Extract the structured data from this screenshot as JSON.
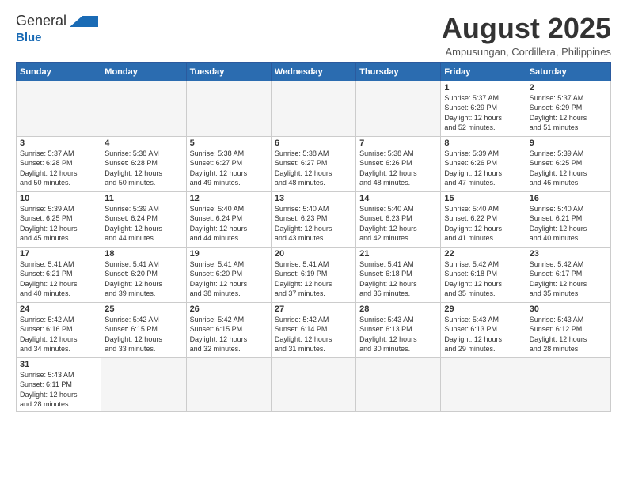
{
  "logo": {
    "line1": "General",
    "line2": "Blue"
  },
  "header": {
    "title": "August 2025",
    "subtitle": "Ampusungan, Cordillera, Philippines"
  },
  "weekdays": [
    "Sunday",
    "Monday",
    "Tuesday",
    "Wednesday",
    "Thursday",
    "Friday",
    "Saturday"
  ],
  "weeks": [
    [
      {
        "day": "",
        "info": ""
      },
      {
        "day": "",
        "info": ""
      },
      {
        "day": "",
        "info": ""
      },
      {
        "day": "",
        "info": ""
      },
      {
        "day": "",
        "info": ""
      },
      {
        "day": "1",
        "info": "Sunrise: 5:37 AM\nSunset: 6:29 PM\nDaylight: 12 hours\nand 52 minutes."
      },
      {
        "day": "2",
        "info": "Sunrise: 5:37 AM\nSunset: 6:29 PM\nDaylight: 12 hours\nand 51 minutes."
      }
    ],
    [
      {
        "day": "3",
        "info": "Sunrise: 5:37 AM\nSunset: 6:28 PM\nDaylight: 12 hours\nand 50 minutes."
      },
      {
        "day": "4",
        "info": "Sunrise: 5:38 AM\nSunset: 6:28 PM\nDaylight: 12 hours\nand 50 minutes."
      },
      {
        "day": "5",
        "info": "Sunrise: 5:38 AM\nSunset: 6:27 PM\nDaylight: 12 hours\nand 49 minutes."
      },
      {
        "day": "6",
        "info": "Sunrise: 5:38 AM\nSunset: 6:27 PM\nDaylight: 12 hours\nand 48 minutes."
      },
      {
        "day": "7",
        "info": "Sunrise: 5:38 AM\nSunset: 6:26 PM\nDaylight: 12 hours\nand 48 minutes."
      },
      {
        "day": "8",
        "info": "Sunrise: 5:39 AM\nSunset: 6:26 PM\nDaylight: 12 hours\nand 47 minutes."
      },
      {
        "day": "9",
        "info": "Sunrise: 5:39 AM\nSunset: 6:25 PM\nDaylight: 12 hours\nand 46 minutes."
      }
    ],
    [
      {
        "day": "10",
        "info": "Sunrise: 5:39 AM\nSunset: 6:25 PM\nDaylight: 12 hours\nand 45 minutes."
      },
      {
        "day": "11",
        "info": "Sunrise: 5:39 AM\nSunset: 6:24 PM\nDaylight: 12 hours\nand 44 minutes."
      },
      {
        "day": "12",
        "info": "Sunrise: 5:40 AM\nSunset: 6:24 PM\nDaylight: 12 hours\nand 44 minutes."
      },
      {
        "day": "13",
        "info": "Sunrise: 5:40 AM\nSunset: 6:23 PM\nDaylight: 12 hours\nand 43 minutes."
      },
      {
        "day": "14",
        "info": "Sunrise: 5:40 AM\nSunset: 6:23 PM\nDaylight: 12 hours\nand 42 minutes."
      },
      {
        "day": "15",
        "info": "Sunrise: 5:40 AM\nSunset: 6:22 PM\nDaylight: 12 hours\nand 41 minutes."
      },
      {
        "day": "16",
        "info": "Sunrise: 5:40 AM\nSunset: 6:21 PM\nDaylight: 12 hours\nand 40 minutes."
      }
    ],
    [
      {
        "day": "17",
        "info": "Sunrise: 5:41 AM\nSunset: 6:21 PM\nDaylight: 12 hours\nand 40 minutes."
      },
      {
        "day": "18",
        "info": "Sunrise: 5:41 AM\nSunset: 6:20 PM\nDaylight: 12 hours\nand 39 minutes."
      },
      {
        "day": "19",
        "info": "Sunrise: 5:41 AM\nSunset: 6:20 PM\nDaylight: 12 hours\nand 38 minutes."
      },
      {
        "day": "20",
        "info": "Sunrise: 5:41 AM\nSunset: 6:19 PM\nDaylight: 12 hours\nand 37 minutes."
      },
      {
        "day": "21",
        "info": "Sunrise: 5:41 AM\nSunset: 6:18 PM\nDaylight: 12 hours\nand 36 minutes."
      },
      {
        "day": "22",
        "info": "Sunrise: 5:42 AM\nSunset: 6:18 PM\nDaylight: 12 hours\nand 35 minutes."
      },
      {
        "day": "23",
        "info": "Sunrise: 5:42 AM\nSunset: 6:17 PM\nDaylight: 12 hours\nand 35 minutes."
      }
    ],
    [
      {
        "day": "24",
        "info": "Sunrise: 5:42 AM\nSunset: 6:16 PM\nDaylight: 12 hours\nand 34 minutes."
      },
      {
        "day": "25",
        "info": "Sunrise: 5:42 AM\nSunset: 6:15 PM\nDaylight: 12 hours\nand 33 minutes."
      },
      {
        "day": "26",
        "info": "Sunrise: 5:42 AM\nSunset: 6:15 PM\nDaylight: 12 hours\nand 32 minutes."
      },
      {
        "day": "27",
        "info": "Sunrise: 5:42 AM\nSunset: 6:14 PM\nDaylight: 12 hours\nand 31 minutes."
      },
      {
        "day": "28",
        "info": "Sunrise: 5:43 AM\nSunset: 6:13 PM\nDaylight: 12 hours\nand 30 minutes."
      },
      {
        "day": "29",
        "info": "Sunrise: 5:43 AM\nSunset: 6:13 PM\nDaylight: 12 hours\nand 29 minutes."
      },
      {
        "day": "30",
        "info": "Sunrise: 5:43 AM\nSunset: 6:12 PM\nDaylight: 12 hours\nand 28 minutes."
      }
    ],
    [
      {
        "day": "31",
        "info": "Sunrise: 5:43 AM\nSunset: 6:11 PM\nDaylight: 12 hours\nand 28 minutes."
      },
      {
        "day": "",
        "info": ""
      },
      {
        "day": "",
        "info": ""
      },
      {
        "day": "",
        "info": ""
      },
      {
        "day": "",
        "info": ""
      },
      {
        "day": "",
        "info": ""
      },
      {
        "day": "",
        "info": ""
      }
    ]
  ]
}
